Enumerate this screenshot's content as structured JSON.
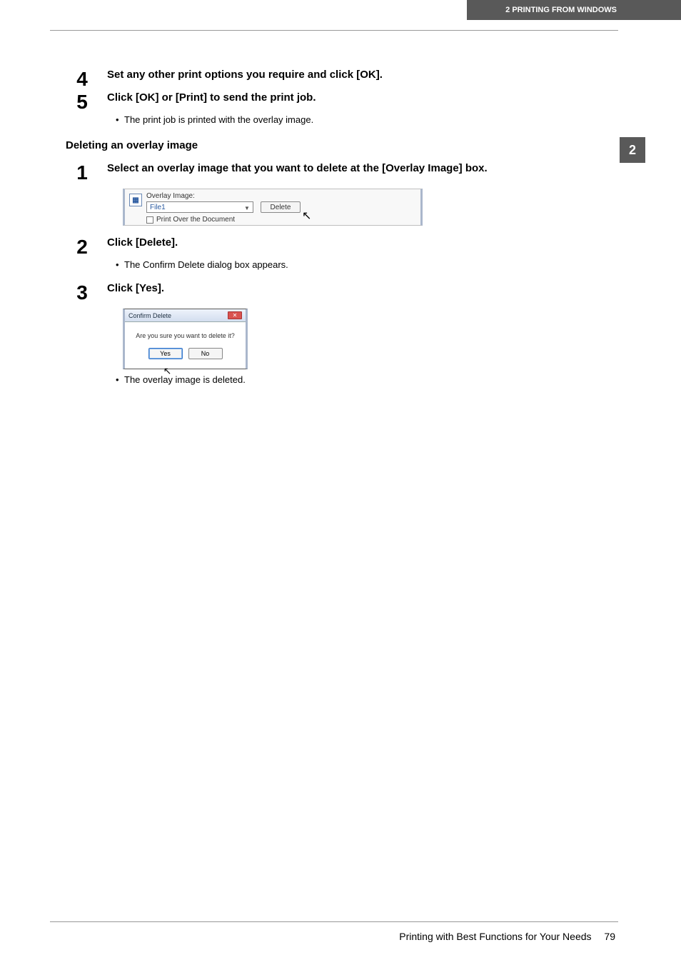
{
  "header": {
    "breadcrumb": "2 PRINTING FROM WINDOWS"
  },
  "sideTab": "2",
  "steps_top": [
    {
      "num": "4",
      "title": "Set any other print options you require and click [OK]."
    },
    {
      "num": "5",
      "title": "Click [OK] or [Print] to send the print job."
    }
  ],
  "bullet_top": "The print job is printed with the overlay image.",
  "section_heading": "Deleting an overlay image",
  "del_steps": {
    "s1": {
      "num": "1",
      "title": "Select an overlay image that you want to delete at the [Overlay Image] box.",
      "shot": {
        "label": "Overlay Image:",
        "selected": "File1",
        "deleteBtn": "Delete",
        "checkbox": "Print Over the Document"
      }
    },
    "s2": {
      "num": "2",
      "title": "Click [Delete].",
      "bullet": "The Confirm Delete dialog box appears."
    },
    "s3": {
      "num": "3",
      "title": "Click [Yes].",
      "shot": {
        "title": "Confirm Delete",
        "message": "Are you sure you want to delete it?",
        "yes": "Yes",
        "no": "No"
      },
      "bullet": "The overlay image is deleted."
    }
  },
  "footer": {
    "text": "Printing with Best Functions for Your Needs",
    "page": "79"
  }
}
